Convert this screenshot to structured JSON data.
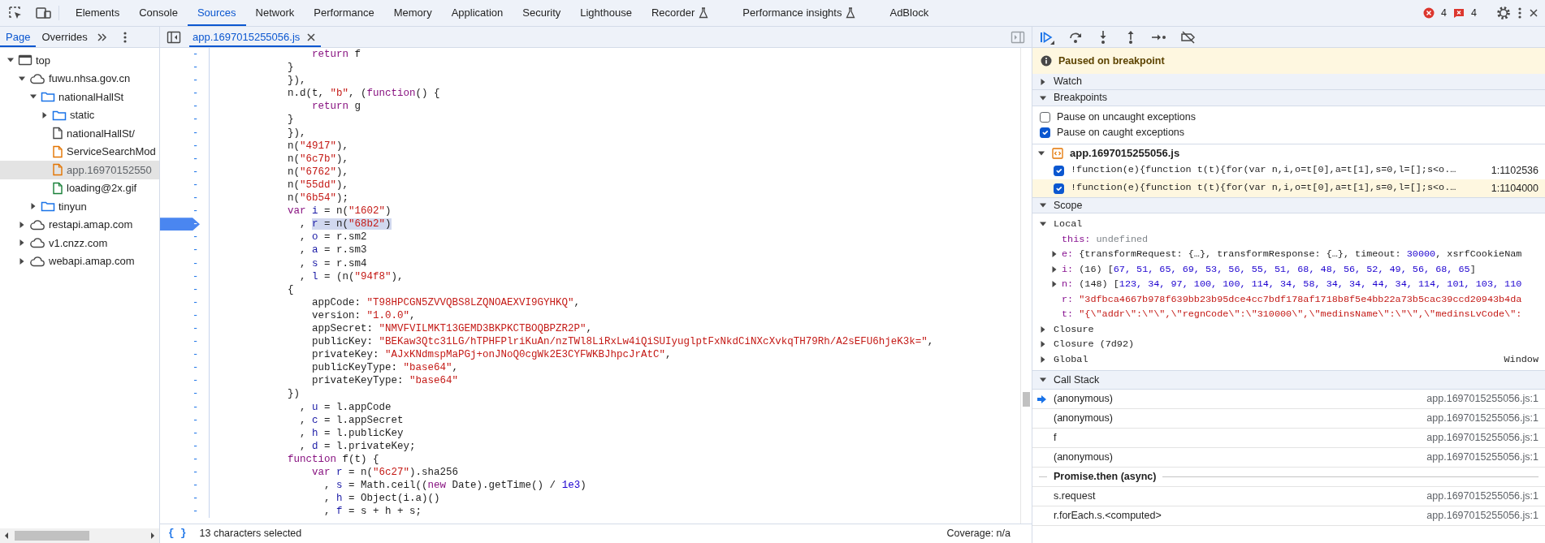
{
  "toolbar": {
    "tabs": [
      {
        "label": "Elements",
        "selected": false,
        "experimental": false
      },
      {
        "label": "Console",
        "selected": false,
        "experimental": false
      },
      {
        "label": "Sources",
        "selected": true,
        "experimental": false
      },
      {
        "label": "Network",
        "selected": false,
        "experimental": false
      },
      {
        "label": "Performance",
        "selected": false,
        "experimental": false
      },
      {
        "label": "Memory",
        "selected": false,
        "experimental": false
      },
      {
        "label": "Application",
        "selected": false,
        "experimental": false
      },
      {
        "label": "Security",
        "selected": false,
        "experimental": false
      },
      {
        "label": "Lighthouse",
        "selected": false,
        "experimental": false
      },
      {
        "label": "Recorder",
        "selected": false,
        "experimental": true
      },
      {
        "label": "Performance insights",
        "selected": false,
        "experimental": true
      },
      {
        "label": "AdBlock",
        "selected": false,
        "experimental": false
      }
    ],
    "error_count": "4",
    "issue_count": "4"
  },
  "navigator": {
    "tabs": [
      {
        "label": "Page",
        "selected": true
      },
      {
        "label": "Overrides",
        "selected": false
      }
    ],
    "tree": [
      {
        "label": "top",
        "kind": "frame",
        "expanded": true,
        "selected": false,
        "children": [
          {
            "label": "fuwu.nhsa.gov.cn",
            "kind": "domain",
            "expanded": true,
            "selected": false,
            "children": [
              {
                "label": "nationalHallSt",
                "kind": "folder",
                "expanded": true,
                "selected": false,
                "children": [
                  {
                    "label": "static",
                    "kind": "folder",
                    "expanded": false,
                    "selected": false
                  },
                  {
                    "label": "nationalHallSt/",
                    "kind": "document",
                    "selected": false
                  },
                  {
                    "label": "ServiceSearchMod",
                    "kind": "script",
                    "selected": false
                  },
                  {
                    "label": "app.16970152550",
                    "kind": "script",
                    "selected": true
                  },
                  {
                    "label": "loading@2x.gif",
                    "kind": "image",
                    "selected": false
                  }
                ]
              },
              {
                "label": "tinyun",
                "kind": "folder",
                "expanded": false,
                "selected": false
              }
            ]
          },
          {
            "label": "restapi.amap.com",
            "kind": "domain",
            "expanded": false,
            "selected": false
          },
          {
            "label": "v1.cnzz.com",
            "kind": "domain",
            "expanded": false,
            "selected": false
          },
          {
            "label": "webapi.amap.com",
            "kind": "domain",
            "expanded": false,
            "selected": false
          }
        ]
      }
    ]
  },
  "editor": {
    "tab": {
      "label": "app.1697015255056.js",
      "selected": true
    },
    "lines": [
      {
        "gutter": "-",
        "breakpoint": false,
        "tokens": [
          {
            "text": "                return",
            "kind": "keyword"
          },
          {
            "text": " f",
            "kind": "plain"
          }
        ]
      },
      {
        "gutter": "-",
        "breakpoint": false,
        "tokens": [
          {
            "text": "            }",
            "kind": "plain"
          }
        ]
      },
      {
        "gutter": "-",
        "breakpoint": false,
        "tokens": [
          {
            "text": "            }),",
            "kind": "plain"
          }
        ]
      },
      {
        "gutter": "-",
        "breakpoint": false,
        "tokens": [
          {
            "text": "            n.d(t, ",
            "kind": "plain"
          },
          {
            "text": "\"b\"",
            "kind": "string"
          },
          {
            "text": ", (",
            "kind": "plain"
          },
          {
            "text": "function",
            "kind": "keyword"
          },
          {
            "text": "() {",
            "kind": "plain"
          }
        ]
      },
      {
        "gutter": "-",
        "breakpoint": false,
        "tokens": [
          {
            "text": "                return",
            "kind": "keyword"
          },
          {
            "text": " g",
            "kind": "plain"
          }
        ]
      },
      {
        "gutter": "-",
        "breakpoint": false,
        "tokens": [
          {
            "text": "            }",
            "kind": "plain"
          }
        ]
      },
      {
        "gutter": "-",
        "breakpoint": false,
        "tokens": [
          {
            "text": "            }),",
            "kind": "plain"
          }
        ]
      },
      {
        "gutter": "-",
        "breakpoint": false,
        "tokens": [
          {
            "text": "            n(",
            "kind": "plain"
          },
          {
            "text": "\"4917\"",
            "kind": "string"
          },
          {
            "text": "),",
            "kind": "plain"
          }
        ]
      },
      {
        "gutter": "-",
        "breakpoint": false,
        "tokens": [
          {
            "text": "            n(",
            "kind": "plain"
          },
          {
            "text": "\"6c7b\"",
            "kind": "string"
          },
          {
            "text": "),",
            "kind": "plain"
          }
        ]
      },
      {
        "gutter": "-",
        "breakpoint": false,
        "tokens": [
          {
            "text": "            n(",
            "kind": "plain"
          },
          {
            "text": "\"6762\"",
            "kind": "string"
          },
          {
            "text": "),",
            "kind": "plain"
          }
        ]
      },
      {
        "gutter": "-",
        "breakpoint": false,
        "tokens": [
          {
            "text": "            n(",
            "kind": "plain"
          },
          {
            "text": "\"55dd\"",
            "kind": "string"
          },
          {
            "text": "),",
            "kind": "plain"
          }
        ]
      },
      {
        "gutter": "-",
        "breakpoint": false,
        "tokens": [
          {
            "text": "            n(",
            "kind": "plain"
          },
          {
            "text": "\"6b54\"",
            "kind": "string"
          },
          {
            "text": ");",
            "kind": "plain"
          }
        ]
      },
      {
        "gutter": "-",
        "breakpoint": false,
        "tokens": [
          {
            "text": "            var",
            "kind": "keyword"
          },
          {
            "text": " i",
            "kind": "variable"
          },
          {
            "text": " = n(",
            "kind": "plain"
          },
          {
            "text": "\"1602\"",
            "kind": "string"
          },
          {
            "text": ")",
            "kind": "plain"
          }
        ]
      },
      {
        "gutter": "-",
        "breakpoint": true,
        "tokens": [
          {
            "text": "              , ",
            "kind": "plain"
          }
        ],
        "selection": [
          {
            "text": "r",
            "kind": "variable"
          },
          {
            "text": " = n(",
            "kind": "plain"
          },
          {
            "text": "\"68b2\"",
            "kind": "string"
          },
          {
            "text": ")",
            "kind": "plain"
          }
        ]
      },
      {
        "gutter": "-",
        "breakpoint": false,
        "tokens": [
          {
            "text": "              , ",
            "kind": "plain"
          },
          {
            "text": "o",
            "kind": "variable"
          },
          {
            "text": " = r.sm2",
            "kind": "plain"
          }
        ]
      },
      {
        "gutter": "-",
        "breakpoint": false,
        "tokens": [
          {
            "text": "              , ",
            "kind": "plain"
          },
          {
            "text": "a",
            "kind": "variable"
          },
          {
            "text": " = r.sm3",
            "kind": "plain"
          }
        ]
      },
      {
        "gutter": "-",
        "breakpoint": false,
        "tokens": [
          {
            "text": "              , ",
            "kind": "plain"
          },
          {
            "text": "s",
            "kind": "variable"
          },
          {
            "text": " = r.sm4",
            "kind": "plain"
          }
        ]
      },
      {
        "gutter": "-",
        "breakpoint": false,
        "tokens": [
          {
            "text": "              , ",
            "kind": "plain"
          },
          {
            "text": "l",
            "kind": "variable"
          },
          {
            "text": " = (n(",
            "kind": "plain"
          },
          {
            "text": "\"94f8\"",
            "kind": "string"
          },
          {
            "text": "),",
            "kind": "plain"
          }
        ]
      },
      {
        "gutter": "-",
        "breakpoint": false,
        "tokens": [
          {
            "text": "            {",
            "kind": "plain"
          }
        ]
      },
      {
        "gutter": "-",
        "breakpoint": false,
        "tokens": [
          {
            "text": "                appCode: ",
            "kind": "plain"
          },
          {
            "text": "\"T98HPCGN5ZVVQBS8LZQNOAEXVI9GYHKQ\"",
            "kind": "string"
          },
          {
            "text": ",",
            "kind": "plain"
          }
        ]
      },
      {
        "gutter": "-",
        "breakpoint": false,
        "tokens": [
          {
            "text": "                version: ",
            "kind": "plain"
          },
          {
            "text": "\"1.0.0\"",
            "kind": "string"
          },
          {
            "text": ",",
            "kind": "plain"
          }
        ]
      },
      {
        "gutter": "-",
        "breakpoint": false,
        "tokens": [
          {
            "text": "                appSecret: ",
            "kind": "plain"
          },
          {
            "text": "\"NMVFVILMKT13GEMD3BKPKCTBOQBPZR2P\"",
            "kind": "string"
          },
          {
            "text": ",",
            "kind": "plain"
          }
        ]
      },
      {
        "gutter": "-",
        "breakpoint": false,
        "tokens": [
          {
            "text": "                publicKey: ",
            "kind": "plain"
          },
          {
            "text": "\"BEKaw3Qtc31LG/hTPHFPlriKuAn/nzTWl8LiRxLw4iQiSUIyuglptFxNkdCiNXcXvkqTH79Rh/A2sEFU6hjeK3k=\"",
            "kind": "string"
          },
          {
            "text": ",",
            "kind": "plain"
          }
        ]
      },
      {
        "gutter": "-",
        "breakpoint": false,
        "tokens": [
          {
            "text": "                privateKey: ",
            "kind": "plain"
          },
          {
            "text": "\"AJxKNdmspMaPGj+onJNoQ0cgWk2E3CYFWKBJhpcJrAtC\"",
            "kind": "string"
          },
          {
            "text": ",",
            "kind": "plain"
          }
        ]
      },
      {
        "gutter": "-",
        "breakpoint": false,
        "tokens": [
          {
            "text": "                publicKeyType: ",
            "kind": "plain"
          },
          {
            "text": "\"base64\"",
            "kind": "string"
          },
          {
            "text": ",",
            "kind": "plain"
          }
        ]
      },
      {
        "gutter": "-",
        "breakpoint": false,
        "tokens": [
          {
            "text": "                privateKeyType: ",
            "kind": "plain"
          },
          {
            "text": "\"base64\"",
            "kind": "string"
          }
        ]
      },
      {
        "gutter": "-",
        "breakpoint": false,
        "tokens": [
          {
            "text": "            })",
            "kind": "plain"
          }
        ]
      },
      {
        "gutter": "-",
        "breakpoint": false,
        "tokens": [
          {
            "text": "              , ",
            "kind": "plain"
          },
          {
            "text": "u",
            "kind": "variable"
          },
          {
            "text": " = l.appCode",
            "kind": "plain"
          }
        ]
      },
      {
        "gutter": "-",
        "breakpoint": false,
        "tokens": [
          {
            "text": "              , ",
            "kind": "plain"
          },
          {
            "text": "c",
            "kind": "variable"
          },
          {
            "text": " = l.appSecret",
            "kind": "plain"
          }
        ]
      },
      {
        "gutter": "-",
        "breakpoint": false,
        "tokens": [
          {
            "text": "              , ",
            "kind": "plain"
          },
          {
            "text": "h",
            "kind": "variable"
          },
          {
            "text": " = l.publicKey",
            "kind": "plain"
          }
        ]
      },
      {
        "gutter": "-",
        "breakpoint": false,
        "tokens": [
          {
            "text": "              , ",
            "kind": "plain"
          },
          {
            "text": "d",
            "kind": "variable"
          },
          {
            "text": " = l.privateKey;",
            "kind": "plain"
          }
        ]
      },
      {
        "gutter": "-",
        "breakpoint": false,
        "tokens": [
          {
            "text": "            function",
            "kind": "keyword"
          },
          {
            "text": " f(t) {",
            "kind": "plain"
          }
        ]
      },
      {
        "gutter": "-",
        "breakpoint": false,
        "tokens": [
          {
            "text": "                var",
            "kind": "keyword"
          },
          {
            "text": " r",
            "kind": "variable"
          },
          {
            "text": " = n(",
            "kind": "plain"
          },
          {
            "text": "\"6c27\"",
            "kind": "string"
          },
          {
            "text": ").sha256",
            "kind": "plain"
          }
        ]
      },
      {
        "gutter": "-",
        "breakpoint": false,
        "tokens": [
          {
            "text": "                  , ",
            "kind": "plain"
          },
          {
            "text": "s",
            "kind": "variable"
          },
          {
            "text": " = Math.ceil((",
            "kind": "plain"
          },
          {
            "text": "new",
            "kind": "keyword"
          },
          {
            "text": " Date).getTime() / ",
            "kind": "plain"
          },
          {
            "text": "1e3",
            "kind": "number"
          },
          {
            "text": ")",
            "kind": "plain"
          }
        ]
      },
      {
        "gutter": "-",
        "breakpoint": false,
        "tokens": [
          {
            "text": "                  , ",
            "kind": "plain"
          },
          {
            "text": "h",
            "kind": "variable"
          },
          {
            "text": " = Object(i.a)()",
            "kind": "plain"
          }
        ]
      },
      {
        "gutter": "-",
        "breakpoint": false,
        "tokens": [
          {
            "text": "                  , ",
            "kind": "plain"
          },
          {
            "text": "f",
            "kind": "variable"
          },
          {
            "text": " = s + h + s;",
            "kind": "plain"
          }
        ]
      }
    ],
    "format_icon": "{ }",
    "status": "13 characters selected",
    "coverage": "Coverage: n/a"
  },
  "debugger": {
    "paused_message": "Paused on breakpoint",
    "watch": {
      "title": "Watch",
      "expanded": false
    },
    "breakpoints": {
      "title": "Breakpoints",
      "expanded": true,
      "options": [
        {
          "label": "Pause on uncaught exceptions",
          "checked": false
        },
        {
          "label": "Pause on caught exceptions",
          "checked": true
        }
      ],
      "files": [
        {
          "name": "app.1697015255056.js",
          "expanded": true,
          "items": [
            {
              "code": "!function(e){function t(t){for(var n,i,o=t[0],a=t[1],s=0,l=[];s<o.…",
              "location": "1:1102536",
              "checked": true,
              "current": false
            },
            {
              "code": "!function(e){function t(t){for(var n,i,o=t[0],a=t[1],s=0,l=[];s<o.…",
              "location": "1:1104000",
              "checked": true,
              "current": true
            }
          ]
        }
      ]
    },
    "scope": {
      "title": "Scope",
      "expanded": true,
      "groups": [
        {
          "name": "Local",
          "expanded": true,
          "properties": [
            {
              "tokens": [
                {
                  "text": "this:",
                  "kind": "name"
                },
                {
                  "text": " undefined",
                  "kind": "undefined"
                }
              ]
            },
            {
              "expanded": false,
              "tokens": [
                {
                  "text": "e:",
                  "kind": "name"
                },
                {
                  "text": " {transformRequest: {…}, transformResponse: {…}, timeout: ",
                  "kind": "plain"
                },
                {
                  "text": "30000",
                  "kind": "number"
                },
                {
                  "text": ", xsrfCookieNam",
                  "kind": "plain"
                }
              ]
            },
            {
              "expanded": false,
              "tokens": [
                {
                  "text": "i:",
                  "kind": "name"
                },
                {
                  "text": " (16) [",
                  "kind": "plain"
                },
                {
                  "text": "67, 51, 65, 69, 53, 56, 55, 51, 68, 48, 56, 52, 49, 56, 68, 65",
                  "kind": "number"
                },
                {
                  "text": "]",
                  "kind": "plain"
                }
              ]
            },
            {
              "expanded": false,
              "tokens": [
                {
                  "text": "n:",
                  "kind": "name"
                },
                {
                  "text": " (148) [",
                  "kind": "plain"
                },
                {
                  "text": "123, 34, 97, 100, 100, 114, 34, 58, 34, 34, 44, 34, 114, 101, 103, 110",
                  "kind": "number"
                }
              ]
            },
            {
              "tokens": [
                {
                  "text": "r:",
                  "kind": "name"
                },
                {
                  "text": " \"3dfbca4667b978f639bb23b95dce4cc7bdf178af1718b8f5e4bb22a73b5cac39ccd20943b4da",
                  "kind": "string"
                }
              ]
            },
            {
              "tokens": [
                {
                  "text": "t:",
                  "kind": "name"
                },
                {
                  "text": " \"{\\\"addr\\\":\\\"\\\",\\\"regnCode\\\":\\\"310000\\\",\\\"medinsName\\\":\\\"\\\",\\\"medinsLvCode\\\":",
                  "kind": "string"
                }
              ]
            }
          ]
        },
        {
          "name": "Closure",
          "expanded": false
        },
        {
          "name": "Closure (7d92)",
          "expanded": false
        },
        {
          "name": "Global",
          "expanded": false,
          "value": "Window"
        }
      ]
    },
    "call_stack": {
      "title": "Call Stack",
      "expanded": true,
      "frames": [
        {
          "kind": "frame",
          "name": "(anonymous)",
          "location": "app.1697015255056.js:1",
          "current": true
        },
        {
          "kind": "frame",
          "name": "(anonymous)",
          "location": "app.1697015255056.js:1",
          "current": false
        },
        {
          "kind": "frame",
          "name": "f",
          "location": "app.1697015255056.js:1",
          "current": false
        },
        {
          "kind": "frame",
          "name": "(anonymous)",
          "location": "app.1697015255056.js:1",
          "current": false
        },
        {
          "kind": "async",
          "name": "Promise.then (async)"
        },
        {
          "kind": "frame",
          "name": "s.request",
          "location": "app.1697015255056.js:1",
          "current": false
        },
        {
          "kind": "frame",
          "name": "r.forEach.s.<computed>",
          "location": "app.1697015255056.js:1",
          "current": false
        }
      ]
    }
  }
}
